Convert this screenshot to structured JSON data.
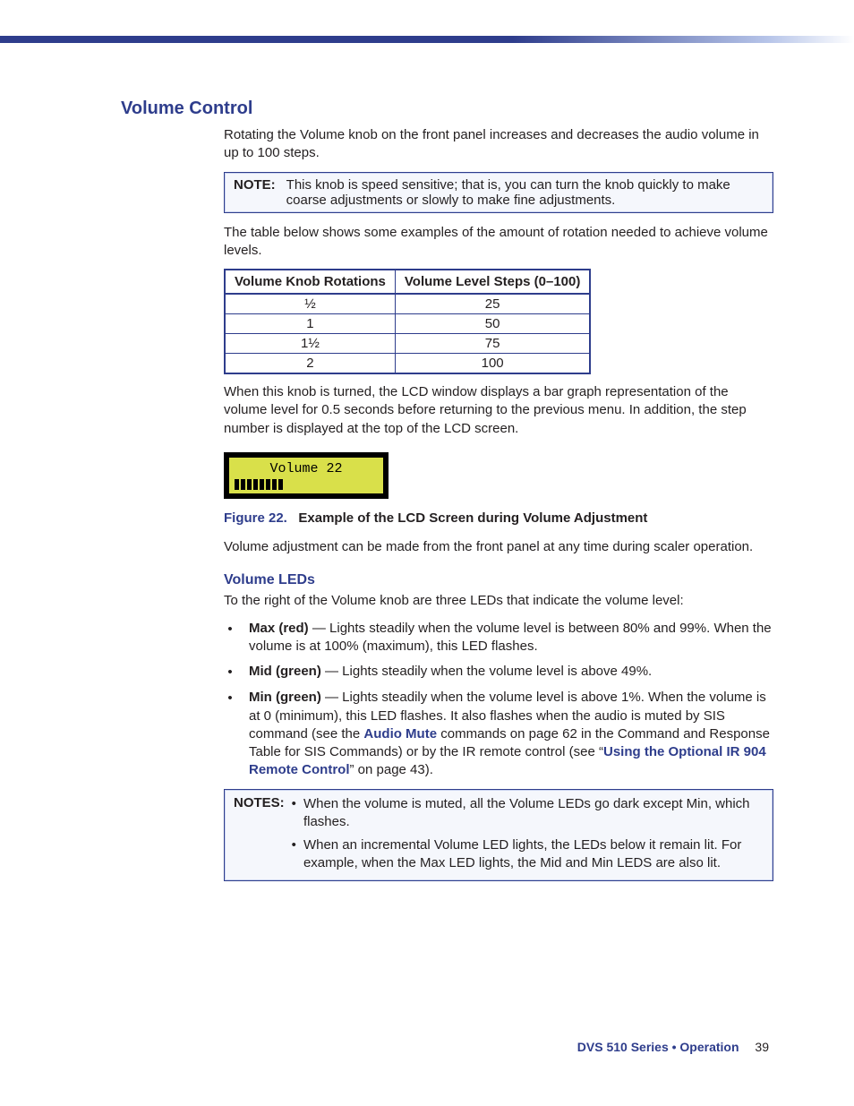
{
  "heading": "Volume Control",
  "intro": "Rotating the Volume knob on the front panel increases and decreases the audio volume in up to 100 steps.",
  "note": {
    "prefix": "NOTE:",
    "text": "This knob is speed sensitive; that is, you can turn the knob quickly to make coarse adjustments or slowly to make fine adjustments."
  },
  "table_intro": "The table below shows some examples of the amount of rotation needed to achieve volume levels.",
  "table": {
    "headers": [
      "Volume Knob Rotations",
      "Volume Level Steps (0–100)"
    ],
    "rows": [
      [
        "½",
        "25"
      ],
      [
        "1",
        "50"
      ],
      [
        "1½",
        "75"
      ],
      [
        "2",
        "100"
      ]
    ]
  },
  "after_table": "When this knob is turned, the LCD window displays a bar graph representation of the volume level for 0.5 seconds before returning to the previous menu. In addition, the step number is displayed at the top of the LCD screen.",
  "lcd": {
    "text": "Volume  22"
  },
  "figure": {
    "num": "Figure 22.",
    "title": "Example of the LCD Screen during Volume Adjustment"
  },
  "after_figure": "Volume adjustment can be made from the front panel at any time during scaler operation.",
  "leds": {
    "heading": "Volume LEDs",
    "intro": "To the right of the Volume knob are three LEDs that indicate the volume level:",
    "items": [
      {
        "label": "Max (red)",
        "text": " — Lights steadily when the volume level is between 80% and 99%. When the volume is at 100% (maximum), this LED flashes."
      },
      {
        "label": "Mid (green)",
        "text": " — Lights steadily when the volume level is above 49%."
      },
      {
        "label": "Min (green)",
        "pre": " — Lights steadily when the volume level is above 1%. When the volume is at 0 (minimum), this LED flashes. It also flashes when the audio is muted by SIS command (see the ",
        "link1": "Audio Mute",
        "mid": " commands on page 62 in the Command and Response Table for SIS Commands) or by the IR remote control (see “",
        "link2": "Using the Optional IR 904 Remote Control",
        "post": "” on page 43)."
      }
    ]
  },
  "notes": {
    "prefix": "NOTES:",
    "items": [
      "When the volume is muted, all the Volume LEDs go dark except Min, which flashes.",
      "When an incremental Volume LED lights, the LEDs below it remain lit. For example, when the Max LED lights, the Mid and Min LEDS are also lit."
    ]
  },
  "footer": {
    "doc": "DVS 510 Series • Operation",
    "page": "39"
  }
}
